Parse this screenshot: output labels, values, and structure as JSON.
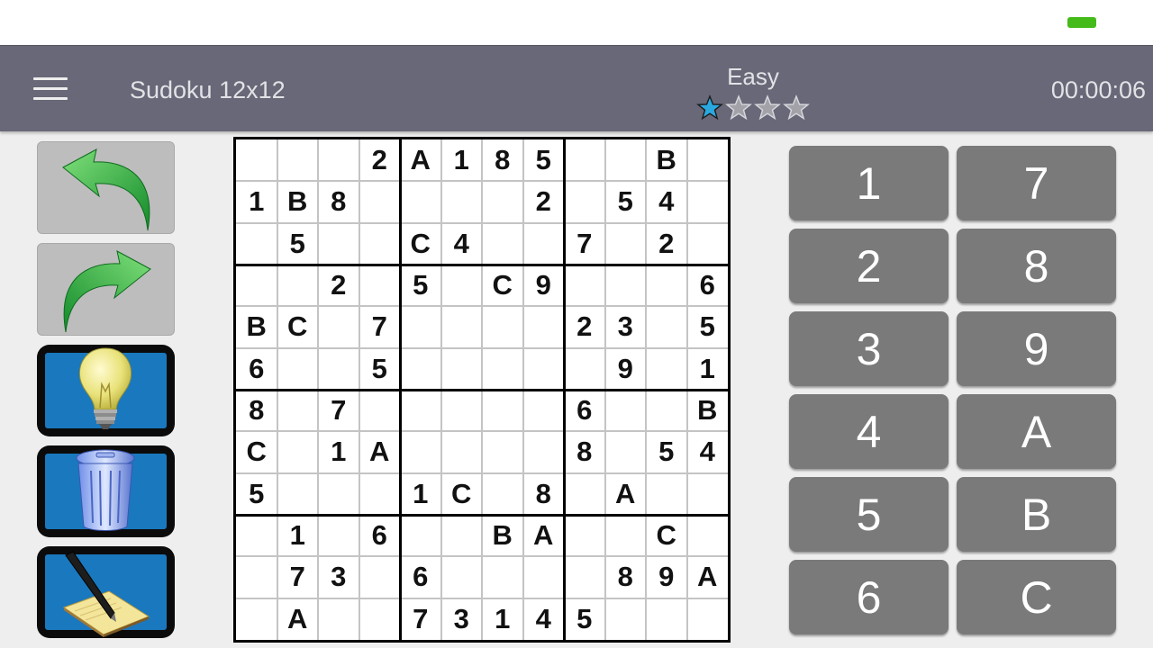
{
  "toolbar": {
    "title": "Sudoku 12x12",
    "difficulty": "Easy",
    "rating": {
      "filled": 1,
      "total": 4
    },
    "timer": "00:00:06"
  },
  "tools": [
    {
      "name": "undo-button",
      "icon": "undo-arrow-icon"
    },
    {
      "name": "redo-button",
      "icon": "redo-arrow-icon"
    },
    {
      "name": "hint-button",
      "icon": "lightbulb-icon"
    },
    {
      "name": "erase-button",
      "icon": "trash-icon"
    },
    {
      "name": "notes-button",
      "icon": "pen-notepad-icon"
    }
  ],
  "colors": {
    "toolbar": "#686878",
    "key": "#7a7a7a",
    "star_active": "#2aa8e0",
    "tool_blue": "#1a78be"
  },
  "grid": [
    [
      "",
      "",
      "",
      "2",
      "A",
      "1",
      "8",
      "5",
      "",
      "",
      "B",
      ""
    ],
    [
      "1",
      "B",
      "8",
      "",
      "",
      "",
      "",
      "2",
      "",
      "5",
      "4",
      ""
    ],
    [
      "",
      "5",
      "",
      "",
      "C",
      "4",
      "",
      "",
      "7",
      "",
      "2",
      ""
    ],
    [
      "",
      "",
      "2",
      "",
      "5",
      "",
      "C",
      "9",
      "",
      "",
      "",
      "6"
    ],
    [
      "B",
      "C",
      "",
      "7",
      "",
      "",
      "",
      "",
      "2",
      "3",
      "",
      "5"
    ],
    [
      "6",
      "",
      "",
      "5",
      "",
      "",
      "",
      "",
      "",
      "9",
      "",
      "1"
    ],
    [
      "8",
      "",
      "7",
      "",
      "",
      "",
      "",
      "",
      "6",
      "",
      "",
      "B"
    ],
    [
      "C",
      "",
      "1",
      "A",
      "",
      "",
      "",
      "",
      "8",
      "",
      "5",
      "4"
    ],
    [
      "5",
      "",
      "",
      "",
      "1",
      "C",
      "",
      "8",
      "",
      "A",
      "",
      ""
    ],
    [
      "",
      "1",
      "",
      "6",
      "",
      "",
      "B",
      "A",
      "",
      "",
      "C",
      ""
    ],
    [
      "",
      "7",
      "3",
      "",
      "6",
      "",
      "",
      "",
      "",
      "8",
      "9",
      "A"
    ],
    [
      "",
      "A",
      "",
      "",
      "7",
      "3",
      "1",
      "4",
      "5",
      "",
      "",
      ""
    ]
  ],
  "keypad": [
    [
      "1",
      "7"
    ],
    [
      "2",
      "8"
    ],
    [
      "3",
      "9"
    ],
    [
      "4",
      "A"
    ],
    [
      "5",
      "B"
    ],
    [
      "6",
      "C"
    ]
  ]
}
